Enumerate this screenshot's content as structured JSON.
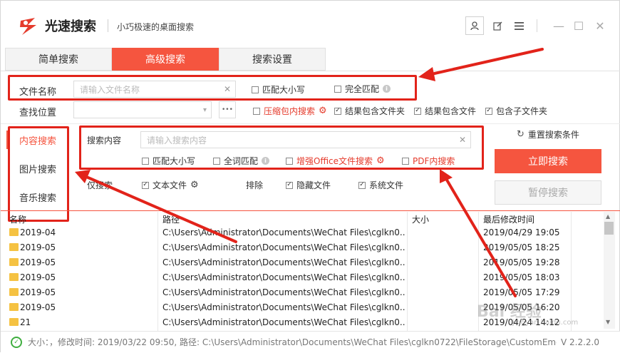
{
  "app": {
    "title": "光速搜索",
    "subtitle": "小巧极速的桌面搜索",
    "brand_color": "#f5553f",
    "annotation_color": "#e2231a"
  },
  "window_controls": {
    "minimize": "—",
    "maximize": "☐",
    "close": "✕"
  },
  "tabs": [
    {
      "label": "简单搜索",
      "active": false
    },
    {
      "label": "高级搜索",
      "active": true
    },
    {
      "label": "搜索设置",
      "active": false
    }
  ],
  "filename": {
    "label": "文件名称",
    "placeholder": "请输入文件名称",
    "match_case": "匹配大小写",
    "exact_match": "完全匹配"
  },
  "location": {
    "label": "查找位置",
    "more_button": "•••",
    "options": [
      {
        "label": "压缩包内搜索",
        "checked": false,
        "highlight": true
      },
      {
        "label": "结果包含文件夹",
        "checked": true
      },
      {
        "label": "结果包含文件",
        "checked": true
      },
      {
        "label": "包含子文件夹",
        "checked": true
      }
    ]
  },
  "left_nav": [
    {
      "label": "内容搜索",
      "active": true
    },
    {
      "label": "图片搜索",
      "active": false
    },
    {
      "label": "音乐搜索",
      "active": false
    }
  ],
  "content_search": {
    "label": "搜索内容",
    "placeholder": "请输入搜索内容",
    "options": [
      {
        "label": "匹配大小写",
        "checked": false
      },
      {
        "label": "全词匹配",
        "checked": false
      },
      {
        "label": "增强Office文件搜索",
        "checked": false,
        "highlight": true
      },
      {
        "label": "PDF内搜索",
        "checked": false,
        "highlight": true
      }
    ]
  },
  "filters": {
    "only_search": "仅搜索",
    "text_files": "文本文件",
    "exclude": "排除",
    "hidden_files": "隐藏文件",
    "system_files": "系统文件"
  },
  "actions": {
    "reset": "重置搜索条件",
    "search_now": "立即搜索",
    "pause": "暂停搜索"
  },
  "table": {
    "columns": [
      "名称",
      "路径",
      "大小",
      "最后修改时间"
    ],
    "rows": [
      {
        "name": "2019-04",
        "path": "C:\\Users\\Administrator\\Documents\\WeChat Files\\cglkn0...",
        "size": "",
        "modified": "2019/04/29 19:05"
      },
      {
        "name": "2019-05",
        "path": "C:\\Users\\Administrator\\Documents\\WeChat Files\\cglkn0...",
        "size": "",
        "modified": "2019/05/05 18:25"
      },
      {
        "name": "2019-05",
        "path": "C:\\Users\\Administrator\\Documents\\WeChat Files\\cglkn0...",
        "size": "",
        "modified": "2019/05/05 19:28"
      },
      {
        "name": "2019-05",
        "path": "C:\\Users\\Administrator\\Documents\\WeChat Files\\cglkn0...",
        "size": "",
        "modified": "2019/05/05 18:03"
      },
      {
        "name": "2019-05",
        "path": "C:\\Users\\Administrator\\Documents\\WeChat Files\\cglkn0...",
        "size": "",
        "modified": "2019/05/05 17:29"
      },
      {
        "name": "2019-05",
        "path": "C:\\Users\\Administrator\\Documents\\WeChat Files\\cglkn0...",
        "size": "",
        "modified": "2019/05/05 16:20"
      },
      {
        "name": "21",
        "path": "C:\\Users\\Administrator\\Documents\\WeChat Files\\cglkn0...",
        "size": "",
        "modified": "2019/04/24 14:12"
      }
    ]
  },
  "status": {
    "text": "大小：，修改时间: 2019/03/22 09:50, 路径: C:\\Users\\Administrator\\Documents\\WeChat Files\\cglkn0722\\FileStorage\\CustomEmotion",
    "version": "V 2.2.2.0"
  },
  "watermark": {
    "text": "Bai 经验",
    "url": "jingyan.baidu.com"
  }
}
